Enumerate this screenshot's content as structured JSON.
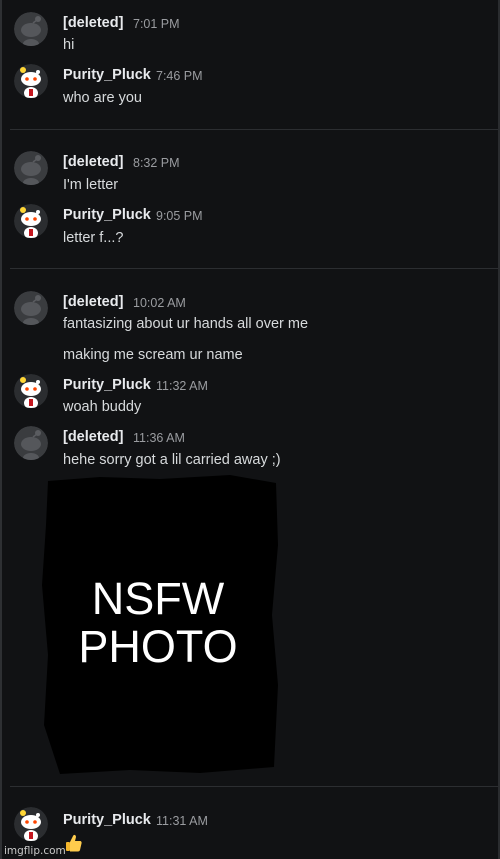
{
  "messages": [
    {
      "user": "[deleted]",
      "time": "7:01 PM",
      "text": "hi",
      "avatar": "deleted-avatar-icon"
    },
    {
      "user": "Purity_Pluck",
      "time": "7:46 PM",
      "text": "who are you",
      "avatar": "reddit-snoo-icon"
    },
    {
      "user": "[deleted]",
      "time": "8:32 PM",
      "text": "I'm letter",
      "avatar": "deleted-avatar-icon"
    },
    {
      "user": "Purity_Pluck",
      "time": "9:05 PM",
      "text": "letter f...?",
      "avatar": "reddit-snoo-icon"
    },
    {
      "user": "[deleted]",
      "time": "10:02 AM",
      "text": "fantasizing about ur hands all over me",
      "text2": "making me scream ur name",
      "avatar": "deleted-avatar-icon"
    },
    {
      "user": "Purity_Pluck",
      "time": "11:32 AM",
      "text": "woah buddy",
      "avatar": "reddit-snoo-icon"
    },
    {
      "user": "[deleted]",
      "time": "11:36 AM",
      "text": "hehe sorry got a lil carried away ;)",
      "avatar": "deleted-avatar-icon"
    },
    {
      "user": "Purity_Pluck",
      "time": "11:31 AM",
      "text": "",
      "avatar": "reddit-snoo-icon",
      "emoji": "thumbs-up-icon"
    }
  ],
  "censor_label": "NSFW PHOTO",
  "watermark": "imgflip.com",
  "colors": {
    "background": "#111214",
    "username": "#e8eaed",
    "timestamp": "#9a9ca0",
    "message": "#d7dadc",
    "censor_block": "#000000"
  }
}
